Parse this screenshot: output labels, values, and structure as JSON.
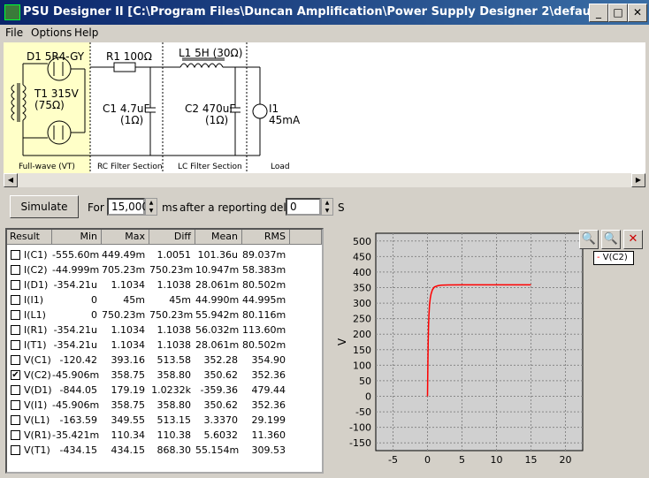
{
  "window": {
    "title": "PSU Designer II  [C:\\Program Files\\Duncan Amplification\\Power Supply Designer 2\\default.psu ] *",
    "minimize_glyph": "_",
    "maximize_glyph": "□",
    "close_glyph": "✕"
  },
  "menu": [
    "File",
    "Options",
    "Help"
  ],
  "schematic": {
    "d1": "D1 5R4-GY",
    "t1_line1": "T1 315V",
    "t1_line2": "(75Ω)",
    "r1": "R1 100Ω",
    "c1_line1": "C1 4.7uF",
    "c1_line2": "(1Ω)",
    "l1": "L1 5H (30Ω)",
    "c2_line1": "C2 470uF",
    "c2_line2": "(1Ω)",
    "i1_line1": "I1",
    "i1_line2": "45mA",
    "sections": [
      "Full-wave (VT)",
      "RC Filter Section",
      "LC Filter Section",
      "Load"
    ]
  },
  "simulate": {
    "button": "Simulate",
    "for_label": "For",
    "duration": "15,000",
    "ms_label": "ms",
    "delay_label": "after a reporting delay of",
    "delay": "0",
    "s_label": "S"
  },
  "table": {
    "headers": [
      "Result",
      "Min",
      "Max",
      "Diff",
      "Mean",
      "RMS"
    ],
    "rows": [
      {
        "name": "I(C1)",
        "checked": false,
        "min": "-555.60m",
        "max": "449.49m",
        "diff": "1.0051",
        "mean": "101.36u",
        "rms": "89.037m"
      },
      {
        "name": "I(C2)",
        "checked": false,
        "min": "-44.999m",
        "max": "705.23m",
        "diff": "750.23m",
        "mean": "10.947m",
        "rms": "58.383m"
      },
      {
        "name": "I(D1)",
        "checked": false,
        "min": "-354.21u",
        "max": "1.1034",
        "diff": "1.1038",
        "mean": "28.061m",
        "rms": "80.502m"
      },
      {
        "name": "I(I1)",
        "checked": false,
        "min": "0",
        "max": "45m",
        "diff": "45m",
        "mean": "44.990m",
        "rms": "44.995m"
      },
      {
        "name": "I(L1)",
        "checked": false,
        "min": "0",
        "max": "750.23m",
        "diff": "750.23m",
        "mean": "55.942m",
        "rms": "80.116m"
      },
      {
        "name": "I(R1)",
        "checked": false,
        "min": "-354.21u",
        "max": "1.1034",
        "diff": "1.1038",
        "mean": "56.032m",
        "rms": "113.60m"
      },
      {
        "name": "I(T1)",
        "checked": false,
        "min": "-354.21u",
        "max": "1.1034",
        "diff": "1.1038",
        "mean": "28.061m",
        "rms": "80.502m"
      },
      {
        "name": "V(C1)",
        "checked": false,
        "min": "-120.42",
        "max": "393.16",
        "diff": "513.58",
        "mean": "352.28",
        "rms": "354.90"
      },
      {
        "name": "V(C2)",
        "checked": true,
        "min": "-45.906m",
        "max": "358.75",
        "diff": "358.80",
        "mean": "350.62",
        "rms": "352.36"
      },
      {
        "name": "V(D1)",
        "checked": false,
        "min": "-844.05",
        "max": "179.19",
        "diff": "1.0232k",
        "mean": "-359.36",
        "rms": "479.44"
      },
      {
        "name": "V(I1)",
        "checked": false,
        "min": "-45.906m",
        "max": "358.75",
        "diff": "358.80",
        "mean": "350.62",
        "rms": "352.36"
      },
      {
        "name": "V(L1)",
        "checked": false,
        "min": "-163.59",
        "max": "349.55",
        "diff": "513.15",
        "mean": "3.3370",
        "rms": "29.199"
      },
      {
        "name": "V(R1)",
        "checked": false,
        "min": "-35.421m",
        "max": "110.34",
        "diff": "110.38",
        "mean": "5.6032",
        "rms": "11.360"
      },
      {
        "name": "V(T1)",
        "checked": false,
        "min": "-434.15",
        "max": "434.15",
        "diff": "868.30",
        "mean": "55.154m",
        "rms": "309.53"
      }
    ]
  },
  "chart_data": {
    "type": "line",
    "ylabel": "V",
    "xlabel": "",
    "xlim": [
      -7.5,
      22.5
    ],
    "ylim": [
      -175,
      525
    ],
    "x_ticks": [
      -5,
      0,
      5,
      10,
      15,
      20
    ],
    "y_ticks": [
      500,
      450,
      400,
      350,
      300,
      250,
      200,
      150,
      100,
      50,
      0,
      -50,
      -100,
      -150
    ],
    "grid": true,
    "legend": "top-right",
    "series": [
      {
        "name": "V(C2)",
        "color": "#ff0000",
        "x": [
          0,
          0.05,
          0.1,
          0.15,
          0.2,
          0.3,
          0.4,
          0.5,
          0.7,
          1.0,
          1.5,
          2.0,
          3.0,
          5.0,
          10.0,
          15.0
        ],
        "y": [
          0,
          100,
          180,
          230,
          260,
          295,
          315,
          328,
          343,
          352,
          356,
          358,
          358.5,
          358.7,
          358.7,
          358.7
        ]
      }
    ]
  },
  "zoom_buttons": [
    "zoom-in-icon",
    "zoom-fit-icon",
    "zoom-reset-icon"
  ]
}
